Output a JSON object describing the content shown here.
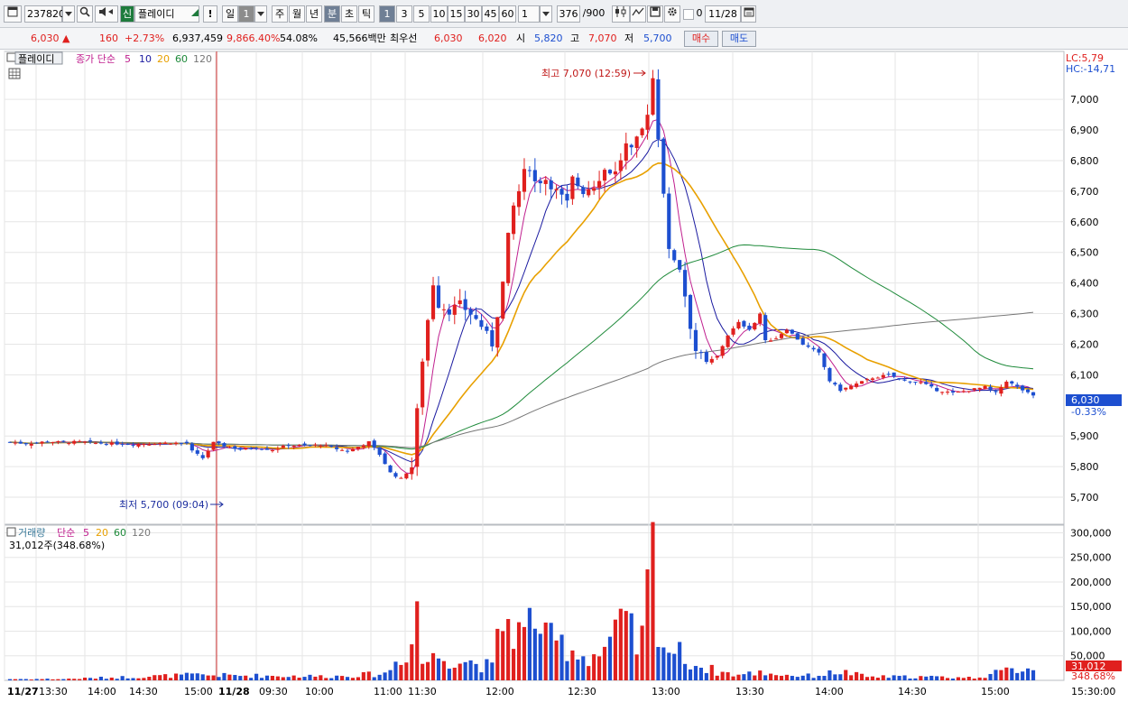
{
  "toolbar": {
    "code": "237820",
    "stock_tag": "신",
    "stock_name": "플레이디",
    "alert": "!",
    "periods": [
      "일",
      "1",
      "주",
      "월",
      "년",
      "분",
      "초",
      "틱"
    ],
    "minutes": [
      "1",
      "3",
      "5",
      "10",
      "15",
      "30",
      "45",
      "60"
    ],
    "interval_value": "1",
    "count": "376",
    "count_max": "/900",
    "checkbox_label": "0",
    "date": "11/28"
  },
  "quote": {
    "price": "6,030",
    "arrow": "▲",
    "change": "160",
    "change_pct": "+2.73%",
    "volume": "6,937,459",
    "volume_ratio": "9,866.40%",
    "turnover": "54.08%",
    "amount": "45,566백만",
    "best_label": "최우선",
    "best_ask": "6,030",
    "best_bid": "6,020",
    "open_label": "시",
    "open": "5,820",
    "high_label": "고",
    "high": "7,070",
    "low_label": "저",
    "low": "5,700",
    "buy_label": "매수",
    "sell_label": "매도"
  },
  "price_panel": {
    "name": "플레이디",
    "ma_title": "종가 단순",
    "ma_periods": [
      "5",
      "10",
      "20",
      "60",
      "120"
    ],
    "lc": "LC:5,79",
    "hc": "HC:-14,71",
    "high_marker": "최고 7,070 (12:59)",
    "low_marker": "최저 5,700 (09:04)",
    "current_price_tag": "6,030",
    "current_change_tag": "-0.33%",
    "y_ticks": [
      "7,000",
      "6,900",
      "6,800",
      "6,700",
      "6,600",
      "6,500",
      "6,400",
      "6,300",
      "6,200",
      "6,100",
      "5,900",
      "5,800",
      "5,700"
    ]
  },
  "volume_panel": {
    "title": "거래량",
    "ma_title": "단순",
    "ma_periods": [
      "5",
      "20",
      "60",
      "120"
    ],
    "current_volume": "31,012주(348.68%)",
    "current_tag": "31,012",
    "current_pct_tag": "348.68%",
    "y_ticks": [
      "300,000",
      "250,000",
      "200,000",
      "150,000",
      "100,000",
      "50,000"
    ]
  },
  "time_axis": {
    "labels": [
      "11/27",
      "13:30",
      "14:00",
      "14:30",
      "15:00",
      "11/28",
      "09:30",
      "10:00",
      "11:00",
      "11:30",
      "12:00",
      "12:30",
      "13:00",
      "13:30",
      "14:00",
      "14:30",
      "15:00",
      "15:30:00"
    ]
  },
  "colors": {
    "up": "#e0201e",
    "down": "#1d4fd0",
    "ma5": "#c0208f",
    "ma10": "#1a1aa0",
    "ma20": "#e8a000",
    "ma60": "#1e8a3a",
    "ma120": "#777777"
  },
  "chart_data": {
    "type": "candlestick",
    "y_range": [
      5650,
      7080
    ],
    "volume_range": [
      0,
      310000
    ],
    "price_path": [
      [
        0,
        5880
      ],
      [
        3,
        5875
      ],
      [
        7,
        5882
      ],
      [
        10,
        5879
      ],
      [
        13,
        5881
      ],
      [
        15,
        5878
      ],
      [
        17,
        5876
      ],
      [
        20,
        5875
      ],
      [
        22,
        5873
      ],
      [
        25,
        5875
      ],
      [
        28,
        5877
      ],
      [
        30,
        5878
      ],
      [
        33,
        5876
      ],
      [
        34,
        5850
      ],
      [
        36,
        5828
      ],
      [
        38,
        5878
      ],
      [
        40,
        5868
      ],
      [
        43,
        5856
      ],
      [
        46,
        5862
      ],
      [
        49,
        5855
      ],
      [
        52,
        5870
      ],
      [
        55,
        5868
      ],
      [
        58,
        5872
      ],
      [
        60,
        5862
      ],
      [
        63,
        5850
      ],
      [
        65,
        5865
      ],
      [
        67,
        5880
      ],
      [
        69,
        5840
      ],
      [
        71,
        5780
      ],
      [
        73,
        5760
      ],
      [
        75,
        5800
      ],
      [
        76,
        5980
      ],
      [
        77,
        6150
      ],
      [
        78,
        6280
      ],
      [
        79,
        6400
      ],
      [
        80,
        6330
      ],
      [
        82,
        6310
      ],
      [
        84,
        6330
      ],
      [
        86,
        6300
      ],
      [
        88,
        6260
      ],
      [
        90,
        6200
      ],
      [
        91,
        6300
      ],
      [
        92,
        6400
      ],
      [
        93,
        6550
      ],
      [
        94,
        6650
      ],
      [
        95,
        6700
      ],
      [
        96,
        6760
      ],
      [
        97,
        6780
      ],
      [
        98,
        6730
      ],
      [
        100,
        6740
      ],
      [
        102,
        6700
      ],
      [
        104,
        6660
      ],
      [
        105,
        6740
      ],
      [
        107,
        6700
      ],
      [
        109,
        6720
      ],
      [
        111,
        6770
      ],
      [
        113,
        6760
      ],
      [
        115,
        6850
      ],
      [
        116,
        6830
      ],
      [
        118,
        6900
      ],
      [
        119,
        6960
      ],
      [
        120,
        7070
      ],
      [
        121,
        6880
      ],
      [
        122,
        6700
      ],
      [
        123,
        6500
      ],
      [
        124,
        6480
      ],
      [
        125,
        6450
      ],
      [
        126,
        6360
      ],
      [
        127,
        6260
      ],
      [
        128,
        6180
      ],
      [
        130,
        6140
      ],
      [
        132,
        6160
      ],
      [
        134,
        6230
      ],
      [
        136,
        6270
      ],
      [
        138,
        6250
      ],
      [
        139,
        6270
      ],
      [
        140,
        6300
      ],
      [
        141,
        6210
      ],
      [
        143,
        6220
      ],
      [
        145,
        6250
      ],
      [
        148,
        6200
      ],
      [
        151,
        6170
      ],
      [
        153,
        6080
      ],
      [
        155,
        6050
      ],
      [
        158,
        6070
      ],
      [
        161,
        6090
      ],
      [
        164,
        6100
      ],
      [
        167,
        6080
      ],
      [
        170,
        6075
      ],
      [
        173,
        6050
      ],
      [
        176,
        6040
      ],
      [
        179,
        6050
      ],
      [
        182,
        6060
      ],
      [
        184,
        6040
      ],
      [
        186,
        6080
      ],
      [
        188,
        6060
      ],
      [
        190,
        6040
      ],
      [
        191,
        6030
      ]
    ],
    "volume_path": [
      [
        0,
        3000
      ],
      [
        10,
        3000
      ],
      [
        34,
        12000
      ],
      [
        60,
        9000
      ],
      [
        70,
        15000
      ],
      [
        75,
        80000
      ],
      [
        76,
        185000
      ],
      [
        77,
        40000
      ],
      [
        80,
        55000
      ],
      [
        85,
        45000
      ],
      [
        90,
        30000
      ],
      [
        92,
        140000
      ],
      [
        94,
        120000
      ],
      [
        96,
        100000
      ],
      [
        98,
        160000
      ],
      [
        100,
        90000
      ],
      [
        104,
        80000
      ],
      [
        107,
        55000
      ],
      [
        110,
        60000
      ],
      [
        113,
        100000
      ],
      [
        115,
        130000
      ],
      [
        117,
        75000
      ],
      [
        118,
        95000
      ],
      [
        120,
        290000
      ],
      [
        121,
        150000
      ],
      [
        122,
        80000
      ],
      [
        125,
        60000
      ],
      [
        128,
        35000
      ],
      [
        132,
        20000
      ],
      [
        136,
        12000
      ],
      [
        140,
        18000
      ],
      [
        145,
        12000
      ],
      [
        150,
        10000
      ],
      [
        155,
        20000
      ],
      [
        160,
        8000
      ],
      [
        170,
        8000
      ],
      [
        180,
        6000
      ],
      [
        190,
        31012
      ]
    ]
  }
}
